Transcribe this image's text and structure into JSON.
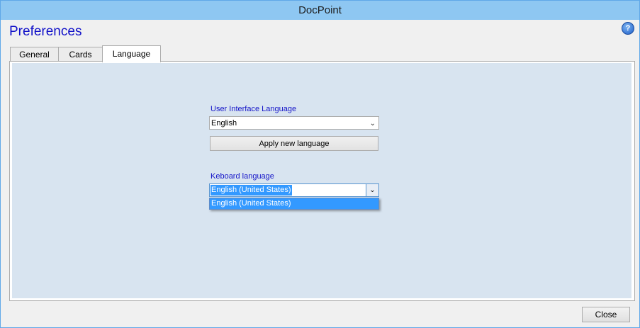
{
  "window": {
    "title": "DocPoint"
  },
  "header": {
    "title": "Preferences",
    "help_icon": "help-icon",
    "help_glyph": "?"
  },
  "tabs": [
    {
      "label": "General",
      "active": false
    },
    {
      "label": "Cards",
      "active": false
    },
    {
      "label": "Language",
      "active": true
    }
  ],
  "language": {
    "ui_label": "User Interface  Language",
    "ui_value": "English",
    "apply_label": "Apply new language",
    "keyboard_label": "Keboard language",
    "keyboard_value": "English (United States)",
    "keyboard_options": [
      "English (United States)"
    ]
  },
  "footer": {
    "close_label": "Close"
  },
  "colors": {
    "accent": "#3399ff",
    "title_bar": "#8ec7f2",
    "panel": "#d8e4f0",
    "label_blue": "#1414c8"
  }
}
